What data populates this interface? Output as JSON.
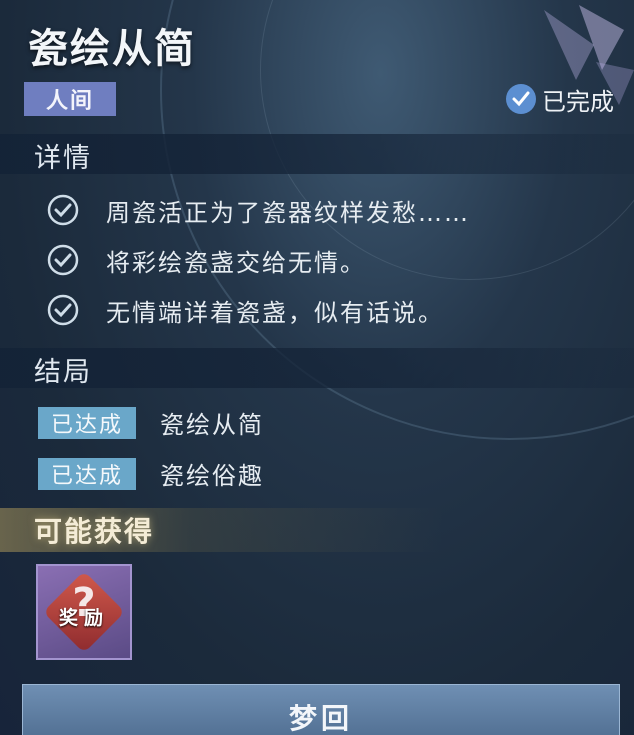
{
  "quest": {
    "title": "瓷绘从简",
    "tag": "人间",
    "status_label": "已完成"
  },
  "details": {
    "heading": "详情",
    "items": [
      "周瓷活正为了瓷器纹样发愁……",
      "将彩绘瓷盏交给无情。",
      "无情端详着瓷盏，似有话说。"
    ]
  },
  "endings": {
    "heading": "结局",
    "items": [
      {
        "badge": "已达成",
        "label": "瓷绘从简"
      },
      {
        "badge": "已达成",
        "label": "瓷绘俗趣"
      }
    ]
  },
  "rewards": {
    "heading": "可能获得",
    "item_symbol": "?",
    "item_label": "奖励"
  },
  "actions": {
    "dream_button": "梦回"
  },
  "colors": {
    "tag_bg": "#6f7ec0",
    "ending_badge_bg": "#6aa7c9",
    "status_check": "#5c8fd1",
    "button_bg": "#5f7ea2"
  }
}
